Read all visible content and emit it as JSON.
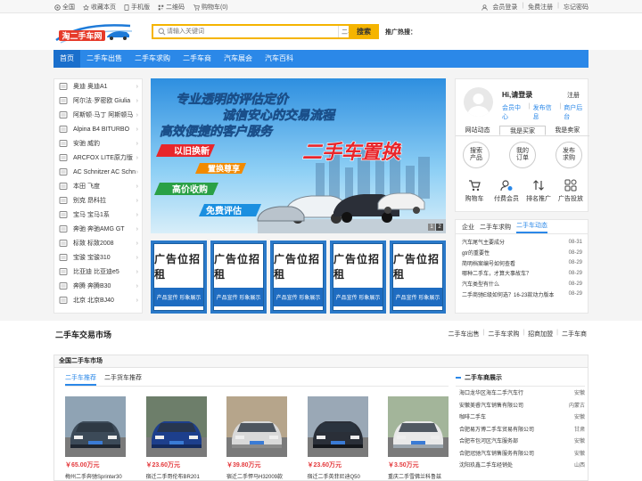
{
  "topbar": {
    "left": [
      "全国",
      "收藏本页",
      "手机版",
      "二维码",
      "购物车(0)"
    ],
    "right": [
      "会员登录",
      "免费注册",
      "忘记密码"
    ]
  },
  "header": {
    "logo_text": "淘二手车网",
    "search_placeholder": "请输入关键词",
    "search_scope": "二手车出1",
    "search_button": "搜索",
    "hot_label": "推广热搜："
  },
  "nav": [
    "首页",
    "二手车出售",
    "二手车求购",
    "二手车商",
    "汽车展会",
    "汽车百科"
  ],
  "sidebar": [
    "奥迪 奥迪A1",
    "阿尔法·罗密欧 Giulia",
    "阿斯顿·马丁 阿斯顿马",
    "Alpina B4 BITURBO",
    "安驰 威豹",
    "ARCFOX LITE原力版",
    "AC Schnitzer AC Schn",
    "本田 飞度",
    "别克 昂科拉",
    "宝马 宝马1系",
    "奔驰 奔驰AMG GT",
    "标致 标致2008",
    "宝骏 宝骏310",
    "比亚迪 比亚迪e5",
    "奔腾 奔腾B30",
    "北京 北京BJ40"
  ],
  "banner": {
    "line1": "专业透明的评估定价",
    "line2": "诚信安心的交易流程",
    "line3": "高效便捷的客户服务",
    "headline": "二手车置换",
    "tag1": "以旧换新",
    "tag2": "置换尊享",
    "tag3": "高价收购",
    "tag4": "免费评估",
    "dots": [
      "1",
      "2"
    ]
  },
  "ads": [
    {
      "title": "广告位招租",
      "sub": "产品宣传 形象展示"
    },
    {
      "title": "广告位招租",
      "sub": "产品宣传 形象展示"
    },
    {
      "title": "广告位招租",
      "sub": "产品宣传 形象展示"
    },
    {
      "title": "广告位招租",
      "sub": "产品宣传 形象展示"
    },
    {
      "title": "广告位招租",
      "sub": "产品宣传 形象展示"
    }
  ],
  "user": {
    "greeting": "Hi,请登录",
    "register": "注册",
    "links": [
      "会员中心",
      "发布信息",
      "商户后台"
    ],
    "tabs": [
      "网站动态",
      "我是买家",
      "我是卖家"
    ],
    "circles": [
      {
        "l1": "搜索",
        "l2": "产品"
      },
      {
        "l1": "我的",
        "l2": "订单"
      },
      {
        "l1": "发布",
        "l2": "求购"
      }
    ],
    "quick": [
      "购物车",
      "付费会员",
      "排名推广",
      "广告投放"
    ]
  },
  "news": {
    "tabs": [
      "企业",
      "二手车求购",
      "二手车动态"
    ],
    "items": [
      {
        "t": "汽车尾气主要成分",
        "d": "08-31"
      },
      {
        "t": "gtr的重要性",
        "d": "08-29"
      },
      {
        "t": "简明档案编号如何查看",
        "d": "08-29"
      },
      {
        "t": "哪种二手车，才算大事故车？",
        "d": "08-29"
      },
      {
        "t": "汽车类型有什么",
        "d": "08-29"
      },
      {
        "t": "二手商驰E级如何选？16-23款动力版本",
        "d": "08-29"
      }
    ]
  },
  "market": {
    "title": "二手车交易市场",
    "links": [
      "二手车出售",
      "二手车求购",
      "招商加盟",
      "二手车商"
    ],
    "box_title": "全国二手车市场",
    "tabs": [
      "二手车推荐",
      "二手货车推荐"
    ],
    "cars": [
      {
        "price": "￥65.00万元",
        "name": "梅州二手奔驰Sprinter30"
      },
      {
        "price": "￥23.60万元",
        "name": "宿迁二手哥伦布BR201"
      },
      {
        "price": "￥39.80万元",
        "name": "宿迁二手悍马H32009款"
      },
      {
        "price": "￥23.60万元",
        "name": "宿迁二手英菲尼迪Q50"
      },
      {
        "price": "￥3.50万元",
        "name": "重庆二手雪佛兰科鲁兹"
      }
    ],
    "dealers_title": "二手车商展示",
    "dealers": [
      {
        "n": "海口龙华区海车二手汽车行",
        "c": "安徽"
      },
      {
        "n": "安徽美睿汽车销售有限公司",
        "c": "内蒙古"
      },
      {
        "n": "咖啡二手车",
        "c": "安徽"
      },
      {
        "n": "合肥易万博二手车贸易有限公司",
        "c": "甘肃"
      },
      {
        "n": "合肥市包河区汽车服务部",
        "c": "安徽"
      },
      {
        "n": "合肥冠驰汽车销售服务有限公司",
        "c": "安徽"
      },
      {
        "n": "沈阳玖鑫二手车经销处",
        "c": "山西"
      }
    ]
  },
  "colors": {
    "brand": "#2b88e8",
    "accent": "#f5b400",
    "price": "#e4393c"
  }
}
